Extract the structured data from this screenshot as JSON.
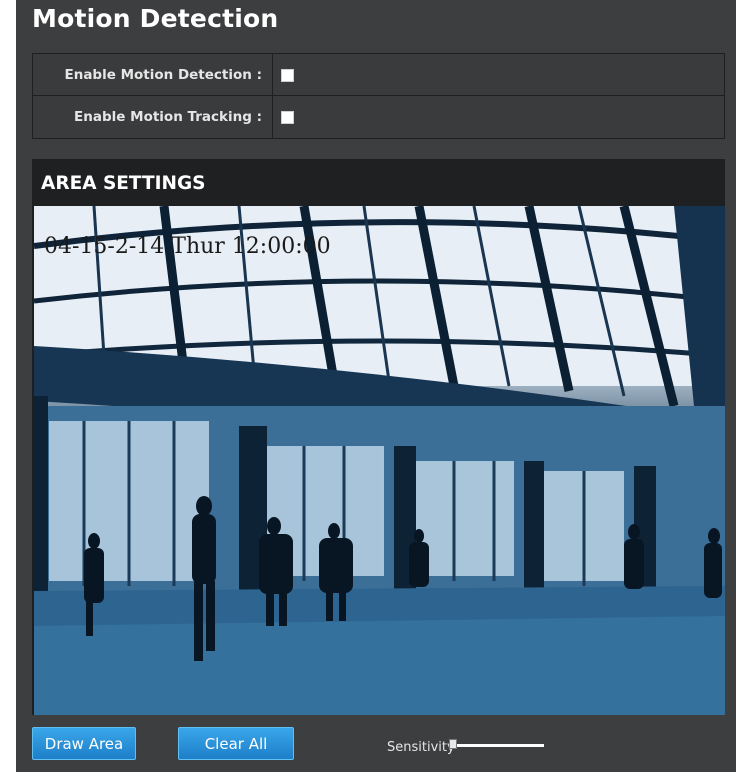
{
  "page": {
    "title": "Motion Detection"
  },
  "options": [
    {
      "label": "Enable Motion Detection :",
      "checked": false
    },
    {
      "label": "Enable Motion Tracking :",
      "checked": false
    }
  ],
  "area": {
    "header": "AREA SETTINGS",
    "timestamp": "04-15-2-14 Thur 12:00:00"
  },
  "buttons": {
    "draw": "Draw Area",
    "clear": "Clear All"
  },
  "sensitivity": {
    "label": "Sensitivity",
    "level": 0
  },
  "colors": {
    "panel": "#3d3e40",
    "button": "#1d7fc8",
    "header": "#1f2022"
  }
}
